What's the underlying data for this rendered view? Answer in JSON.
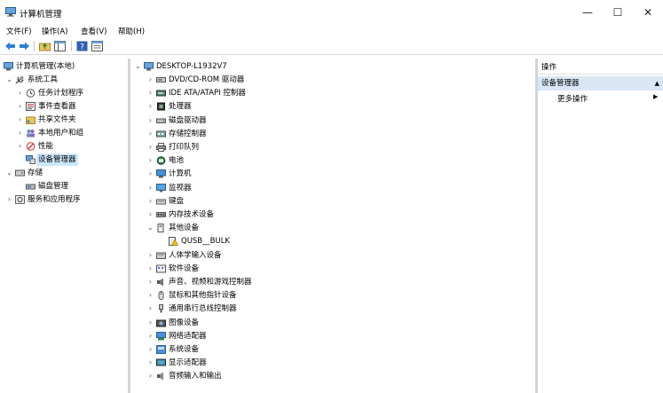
{
  "window": {
    "title": "计算机管理",
    "controls": {
      "minimize": "—",
      "maximize": "☐",
      "close": "✕"
    }
  },
  "menu": [
    "文件(F)",
    "操作(A)",
    "查看(V)",
    "帮助(H)"
  ],
  "toolbar": {
    "icons": [
      "back-icon",
      "forward-icon",
      "up-folder-icon",
      "show-hide-tree-icon",
      "help-icon",
      "properties-icon"
    ]
  },
  "left_tree": [
    {
      "label": "计算机管理(本地)",
      "level": 0,
      "expander": "",
      "icon": "computer-management-icon"
    },
    {
      "label": "系统工具",
      "level": 1,
      "expander": "⌄",
      "icon": "tools-icon"
    },
    {
      "label": "任务计划程序",
      "level": 2,
      "expander": "›",
      "icon": "clock-icon"
    },
    {
      "label": "事件查看器",
      "level": 2,
      "expander": "›",
      "icon": "event-viewer-icon"
    },
    {
      "label": "共享文件夹",
      "level": 2,
      "expander": "›",
      "icon": "shared-folder-icon"
    },
    {
      "label": "本地用户和组",
      "level": 2,
      "expander": "›",
      "icon": "users-icon"
    },
    {
      "label": "性能",
      "level": 2,
      "expander": "›",
      "icon": "performance-icon"
    },
    {
      "label": "设备管理器",
      "level": 2,
      "expander": "",
      "icon": "device-manager-icon",
      "selected": true
    },
    {
      "label": "存储",
      "level": 1,
      "expander": "⌄",
      "icon": "storage-icon"
    },
    {
      "label": "磁盘管理",
      "level": 2,
      "expander": "",
      "icon": "disk-management-icon"
    },
    {
      "label": "服务和应用程序",
      "level": 1,
      "expander": "›",
      "icon": "services-icon"
    }
  ],
  "device_tree": {
    "root": "DESKTOP-L1932V7",
    "items": [
      {
        "label": "DVD/CD-ROM 驱动器",
        "icon": "dvd-drive-icon",
        "expander": "›"
      },
      {
        "label": "IDE ATA/ATAPI 控制器",
        "icon": "ide-controller-icon",
        "expander": "›"
      },
      {
        "label": "处理器",
        "icon": "processor-icon",
        "expander": "›"
      },
      {
        "label": "磁盘驱动器",
        "icon": "disk-drive-icon",
        "expander": "›"
      },
      {
        "label": "存储控制器",
        "icon": "storage-controller-icon",
        "expander": "›"
      },
      {
        "label": "打印队列",
        "icon": "printer-icon",
        "expander": "›"
      },
      {
        "label": "电池",
        "icon": "battery-icon",
        "expander": "›"
      },
      {
        "label": "计算机",
        "icon": "computer-icon",
        "expander": "›"
      },
      {
        "label": "监视器",
        "icon": "monitor-icon",
        "expander": "›"
      },
      {
        "label": "键盘",
        "icon": "keyboard-icon",
        "expander": "›"
      },
      {
        "label": "内存技术设备",
        "icon": "memory-device-icon",
        "expander": "›"
      },
      {
        "label": "其他设备",
        "icon": "other-devices-icon",
        "expander": "⌄"
      },
      {
        "label": "QUSB__BULK",
        "icon": "warning-device-icon",
        "expander": "",
        "child": true
      },
      {
        "label": "人体学输入设备",
        "icon": "hid-icon",
        "expander": "›"
      },
      {
        "label": "软件设备",
        "icon": "software-device-icon",
        "expander": "›"
      },
      {
        "label": "声音、视频和游戏控制器",
        "icon": "sound-icon",
        "expander": "›"
      },
      {
        "label": "鼠标和其他指针设备",
        "icon": "mouse-icon",
        "expander": "›"
      },
      {
        "label": "通用串行总线控制器",
        "icon": "usb-icon",
        "expander": "›"
      },
      {
        "label": "图像设备",
        "icon": "camera-icon",
        "expander": "›"
      },
      {
        "label": "网络适配器",
        "icon": "network-adapter-icon",
        "expander": "›"
      },
      {
        "label": "系统设备",
        "icon": "system-device-icon",
        "expander": "›"
      },
      {
        "label": "显示适配器",
        "icon": "display-adapter-icon",
        "expander": "›"
      },
      {
        "label": "音频输入和输出",
        "icon": "audio-io-icon",
        "expander": "›"
      }
    ]
  },
  "actions": {
    "header": "操作",
    "section": "设备管理器",
    "section_caret": "▲",
    "more": "更多操作",
    "more_arrow": "▶"
  },
  "colors": {
    "selection": "#cce8ff",
    "actions_section_bg": "#d9e6f4",
    "divider": "#d4d4d4"
  }
}
